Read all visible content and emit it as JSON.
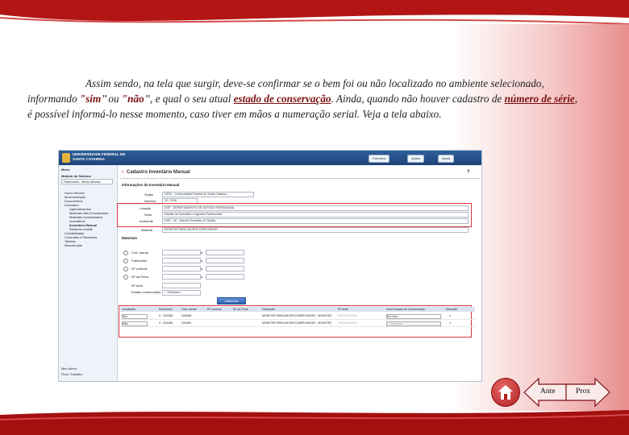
{
  "slide": {
    "paragraph": {
      "p1": "Assim sendo, na tela que surgir, deve-se confirmar se o bem foi ou não localizado no ambiente selecionado, informando ",
      "sim": "\"sim",
      "p2": "’’ ou ",
      "nao": "\"não",
      "p3": "’’, e qual o seu atual ",
      "estado": "estado de conservação",
      "p4": ". Ainda, quando não houver cadastro de ",
      "numero": "número de série",
      "p5": ", é possível informá-lo nesse momento, caso tiver em mãos a numeração serial. Veja a tela abaixo."
    },
    "nav": {
      "prev_label": "Ante",
      "next_label": "Prox"
    },
    "colors": {
      "band": "#9e0d0d",
      "accent": "#7a1010"
    }
  },
  "screenshot": {
    "header": {
      "university": "UNIVERSIDADE FEDERAL DE SANTA CATARINA",
      "btn_favorites": "Favoritos",
      "btn_actions": "Ações",
      "btn_help": "Ajuda"
    },
    "sidebar": {
      "menu": "Menu",
      "module_label": "Módulo do Sistema",
      "module_value": "Patrimônio - Bens Móveis",
      "items": [
        "Home Móveis",
        "Movimentação",
        "Documentos",
        "Inventário",
        "Agendamentos",
        "Materiais Não Encontrados",
        "Materiais Inventariados",
        "Inventários",
        "Inventário Manual",
        "Relatório mobile",
        "Contabilidade",
        "Consultas e Relatórios",
        "Tabelas",
        "Manutenção"
      ],
      "bottom": [
        "Meu Menu",
        "Fluxo Trabalho"
      ]
    },
    "page_title": "Cadastro Inventário Manual",
    "section_info": "Informações do Inventário Manual",
    "fields": [
      {
        "label": "Órgão",
        "value": "UFSC - Universidade Federal de Santa Catarina"
      },
      {
        "label": "Número",
        "value": "10 / 2016"
      },
      {
        "label": "Lotação",
        "value": "DGP - DEPARTAMENTO DE GESTÃO PATRIMONIAL"
      },
      {
        "label": "Setor",
        "value": "Divisão de Inventário e Agentes Patrimoniais"
      },
      {
        "label": "Ambiente",
        "value": "DGP - 18 - Sala de Reuniões (1º Andar)"
      },
      {
        "label": "Material",
        "value": "MONITOR PARA MICROCOMPUTADOR"
      }
    ],
    "section_items": "Materiais",
    "filters": [
      "Cód. barras",
      "Patrimônio",
      "Nº controle",
      "Nº da Ficha",
      "Nº série",
      "Estado conservação"
    ],
    "filter_e": "a",
    "select_placeholder": "-- Selecione --",
    "add_button": "Adicionar",
    "table": {
      "headers": [
        "Localizado",
        "Patrimônio",
        "Cód. barras",
        "Nº controle",
        "Nº da Ficha",
        "Descrição",
        "Nº série",
        "Novo Estado de Conservação",
        "Situação"
      ],
      "rows": [
        {
          "localizado": "Sim",
          "patrimonio": "0 - 334458",
          "codigo": "334458",
          "descricao": "MONITOR PARA MICROCOMPUTADOR - MONITOR",
          "serie": "XXXXXXXXXX",
          "estado": "Em Uso"
        },
        {
          "localizado": "Não",
          "patrimonio": "0 - 334459",
          "codigo": "334459",
          "descricao": "MONITOR PARA MICROCOMPUTADOR - MONITOR",
          "serie": "XXXXXXXXXX",
          "estado": "-- Selecione --"
        }
      ]
    }
  }
}
